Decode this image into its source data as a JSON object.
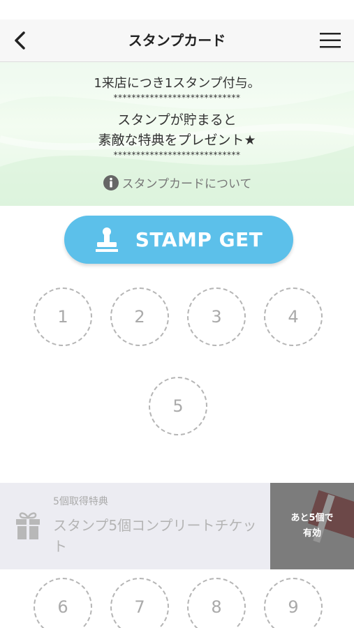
{
  "header": {
    "title": "スタンプカード",
    "back_icon": "chevron-left-icon",
    "menu_icon": "hamburger-menu-icon"
  },
  "banner": {
    "line1": "1来店につき1スタンプ付与。",
    "separator": "****************************",
    "line2": "スタンプが貯まると",
    "line3": "素敵な特典をプレゼント★",
    "about_link": "スタンプカードについて"
  },
  "stamp_button": {
    "label": "STAMP GET",
    "icon": "stamp-icon",
    "color": "#5cc0ea"
  },
  "stamps": [
    "1",
    "2",
    "3",
    "4",
    "5",
    "6",
    "7",
    "8",
    "9"
  ],
  "reward": {
    "subtitle": "5個取得特典",
    "title": "スタンプ5個コンプリートチケット",
    "remaining_line1": "あと5個で",
    "remaining_line2": "有効",
    "icon": "gift-icon"
  }
}
